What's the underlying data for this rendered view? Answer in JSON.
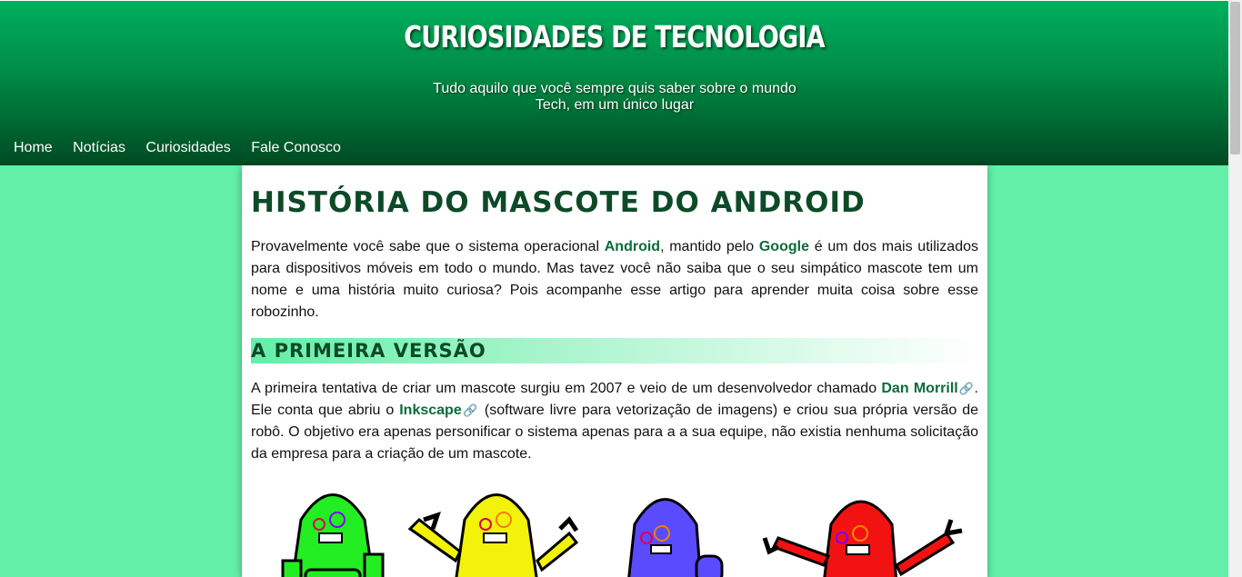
{
  "header": {
    "title": "CURIOSIDADES DE TECNOLOGIA",
    "subtitle_line1": "Tudo aquilo que você sempre quis saber sobre o mundo",
    "subtitle_line2": "Tech, em um único lugar"
  },
  "nav": {
    "items": [
      "Home",
      "Notícias",
      "Curiosidades",
      "Fale Conosco"
    ]
  },
  "article": {
    "title": "História do mascote do Android",
    "p1": {
      "t1": "Provavelmente você sabe que o sistema operacional ",
      "link1": "Android",
      "t2": ", mantido pelo ",
      "link2": "Google",
      "t3": " é um dos mais utilizados para dispositivos móveis em todo o mundo. Mas tavez você não saiba que o seu simpático mascote tem um nome e uma história muito curiosa? Pois acompanhe esse artigo para aprender muita coisa sobre esse robozinho."
    },
    "section1_heading": "A primeira versão",
    "p2": {
      "t1": "A primeira tentativa de criar um mascote surgiu em 2007 e veio de um desenvolvedor chamado ",
      "link1": "Dan Morrill",
      "t2": ". Ele conta que abriu o ",
      "link2": "Inkscape",
      "t3": " (software livre para vetorização de imagens) e criou sua própria versão de robô. O objetivo era apenas personificar o sistema apenas para a a sua equipe, não existia nenhuma solicitação da empresa para a criação de um mascote."
    },
    "link_icon": "🔗"
  },
  "robots": {
    "colors": [
      "#22ee22",
      "#f2f20a",
      "#5a4bff",
      "#f21212"
    ]
  }
}
